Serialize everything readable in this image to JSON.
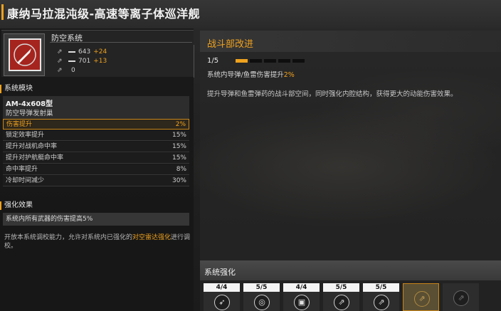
{
  "title": "康纳马拉混沌级-高速等离子体巡洋舰",
  "system": {
    "name": "防空系统",
    "stats": [
      {
        "icon": "range-icon",
        "value": "643",
        "bonus": "+24"
      },
      {
        "icon": "range-icon",
        "value": "701",
        "bonus": "+13"
      },
      {
        "icon": "range-icon",
        "value": "0",
        "bonus": ""
      }
    ]
  },
  "modules": {
    "header": "系统模块",
    "name": "AM-4x608型",
    "subtitle": "防空导弹发射巢",
    "rows": [
      {
        "label": "伤害提升",
        "value": "2%",
        "active": true
      },
      {
        "label": "锁定效率提升",
        "value": "15%",
        "active": false
      },
      {
        "label": "提升对战机命中率",
        "value": "15%",
        "active": false
      },
      {
        "label": "提升对护航艇命中率",
        "value": "15%",
        "active": false
      },
      {
        "label": "命中率提升",
        "value": "8%",
        "active": false
      },
      {
        "label": "冷却时间减少",
        "value": "30%",
        "active": false
      }
    ]
  },
  "enhancement": {
    "header": "强化效果",
    "effect": "系统内所有武器的伤害提高5%",
    "desc_pre": "开放本系统调校能力，允许对系统内已强化的",
    "desc_highlight": "对空雷达强化",
    "desc_post": "进行调校。"
  },
  "upgrade": {
    "title": "战斗部改进",
    "progress": "1/5",
    "progress_current": 1,
    "progress_total": 5,
    "effect_pre": "系统内导弹/鱼雷伤害提升",
    "effect_value": "2%",
    "description": "提升导弹和鱼雷弹药的战斗部空间，同时强化内腔结构，获得更大的动能伤害效果。"
  },
  "strengthen": {
    "title": "系统强化",
    "slots": [
      {
        "count": "4/4",
        "icon": "missile-icon",
        "glyph": "➶",
        "state": "normal"
      },
      {
        "count": "5/5",
        "icon": "target-icon",
        "glyph": "◎",
        "state": "normal"
      },
      {
        "count": "4/4",
        "icon": "chip-icon",
        "glyph": "▣",
        "state": "normal"
      },
      {
        "count": "5/5",
        "icon": "rocket-icon",
        "glyph": "⇗",
        "state": "normal"
      },
      {
        "count": "5/5",
        "icon": "rocket-icon",
        "glyph": "⇗",
        "state": "normal"
      },
      {
        "count": "",
        "icon": "warhead-icon",
        "glyph": "⇗",
        "state": "selected"
      },
      {
        "count": "",
        "icon": "warhead-icon",
        "glyph": "⇗",
        "state": "locked"
      }
    ]
  },
  "colors": {
    "accent": "#f0a21e",
    "icon_red": "#a6241e"
  }
}
